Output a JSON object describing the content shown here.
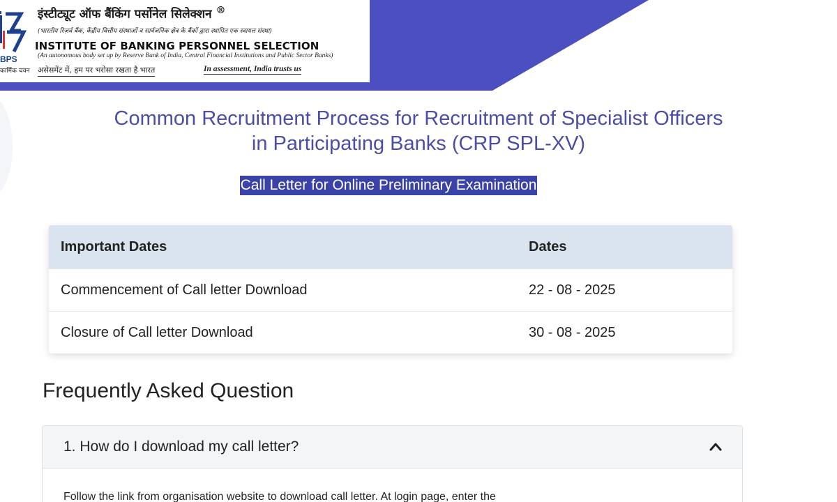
{
  "header": {
    "org_name_hindi": "इंस्टीट्यूट ऑफ बैंकिंग पर्सोनेल सिलेक्शन",
    "registered_mark": "®",
    "org_desc_hindi": "(भारतीय रिज़र्व बैंक, केंद्रीय वित्तीय संस्थाओं व सार्वजनिक क्षेत्र के बैंकों द्वारा स्थापित एक स्वायत्त संस्था)",
    "org_name_english": "INSTITUTE OF BANKING PERSONNEL SELECTION",
    "org_desc_english": "(An autonomous body set up by Reserve Bank of India, Central Financial Institutions and Public Sector Banks)",
    "motto_hindi": "असेसमेंट में, हम पर भरोसा रखता है भारत",
    "motto_english": "In assessment, India trusts us",
    "logo_short": "BPS",
    "logo_short_hindi": "कार्मिक चयन",
    "brand_color": "#4c4fc0"
  },
  "title": {
    "line1": "Common Recruitment Process for Recruitment of Specialist Officers",
    "line2": "in Participating Banks (CRP SPL-XV)",
    "subtitle": "Call Letter for Online Preliminary Examination"
  },
  "dates_table": {
    "headers": [
      "Important Dates",
      "Dates"
    ],
    "rows": [
      {
        "label": "Commencement of Call letter Download",
        "date": "22 - 08 - 2025"
      },
      {
        "label": "Closure of Call letter Download",
        "date": "30 - 08 - 2025"
      }
    ]
  },
  "faq": {
    "heading": "Frequently Asked Question",
    "items": [
      {
        "question": "1. How do I download my call letter?",
        "icon": "chevron-up-icon",
        "answer": "Follow the link from organisation website to download call letter. At login page, enter the"
      }
    ]
  }
}
